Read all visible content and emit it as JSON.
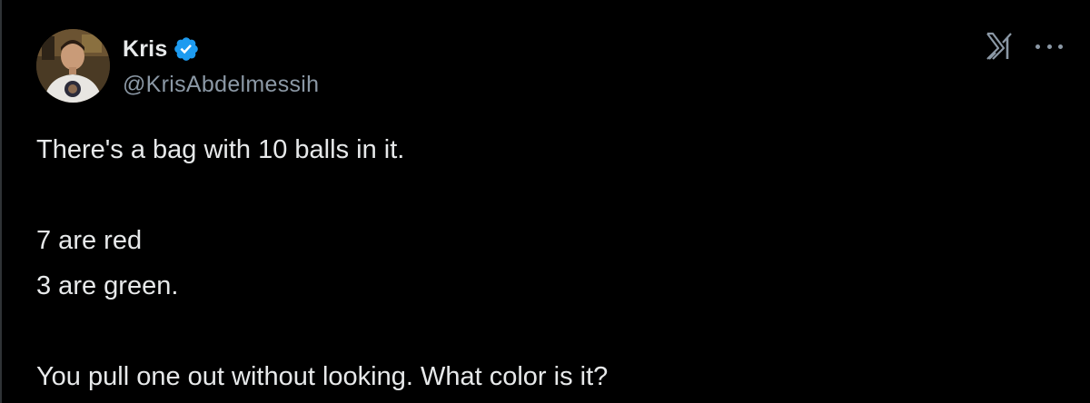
{
  "author": {
    "display_name": "Kris",
    "handle": "@KrisAbdelmessih",
    "verified": true,
    "verified_color": "#1d9bf0"
  },
  "header_actions": {
    "logo_icon": "x-logo-icon",
    "more_icon": "more-options-icon"
  },
  "tweet": {
    "lines": [
      "There's a bag with 10 balls in it.",
      "",
      "7 are red",
      "3 are green.",
      "",
      "You pull one out without looking. What color is it?"
    ]
  },
  "colors": {
    "background": "#000000",
    "text": "#e7e9ea",
    "secondary_text": "#8b98a5"
  }
}
